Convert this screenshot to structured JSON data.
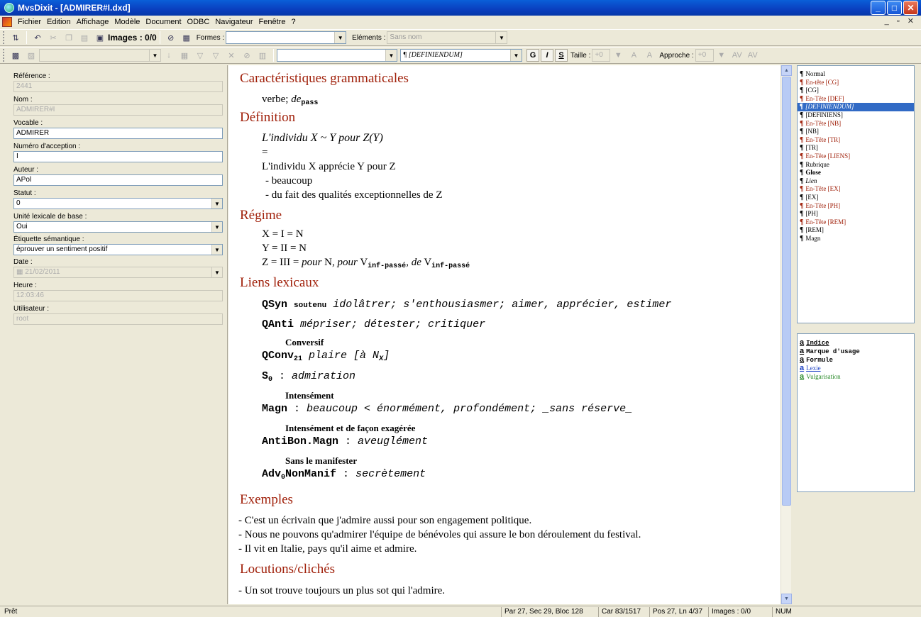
{
  "window": {
    "title": "MvsDixit - [ADMIRER#I.dxd]"
  },
  "menu": [
    "Fichier",
    "Edition",
    "Affichage",
    "Modèle",
    "Document",
    "ODBC",
    "Navigateur",
    "Fenêtre",
    "?"
  ],
  "toolbar1": {
    "images_label": "Images : 0/0",
    "formes_label": "Formes :",
    "formes_value": "",
    "elements_label": "Eléments :",
    "elements_value": "Sans nom"
  },
  "toolbar2": {
    "font_value": "",
    "style_value": "¶ [DEFINIENDUM]",
    "bold": "G",
    "italic": "I",
    "underline": "S",
    "taille_label": "Taille :",
    "taille_value": "+0",
    "approche_label": "Approche :",
    "approche_value": "+0"
  },
  "fields": {
    "reference": {
      "label": "Référence :",
      "value": "2441"
    },
    "nom": {
      "label": "Nom :",
      "value": "ADMIRER#I"
    },
    "vocable": {
      "label": "Vocable :",
      "value": "ADMIRER"
    },
    "numero": {
      "label": "Numéro d'acception :",
      "value": "I"
    },
    "auteur": {
      "label": "Auteur :",
      "value": "APol"
    },
    "statut": {
      "label": "Statut :",
      "value": "0"
    },
    "unite": {
      "label": "Unité lexicale de base :",
      "value": "Oui"
    },
    "etiquette": {
      "label": "Étiquette sémantique :",
      "value": "éprouver un sentiment positif"
    },
    "date": {
      "label": "Date :",
      "value": "21/02/2011"
    },
    "heure": {
      "label": "Heure :",
      "value": "12:03:46"
    },
    "utilisateur": {
      "label": "Utilisateur :",
      "value": "root"
    }
  },
  "doc": {
    "cg_heading": "Caractéristiques grammaticales",
    "cg_text": "verbe; ",
    "cg_de": "de",
    "cg_pass": "pass",
    "def_heading": "Définition",
    "def_formula": "L'individu X ~ Y pour Z(Y)",
    "def_eq": "=",
    "def_line1": "L'individu X apprécie Y pour Z",
    "def_line2": "- beaucoup",
    "def_line3": "- du fait des qualités exceptionnelles de Z",
    "regime_heading": "Régime",
    "regime1": "X = I = N",
    "regime2": "Y = II = N",
    "regime3_a": "Z = III = ",
    "regime3_pour1": "pour",
    "regime3_b": " N, ",
    "regime3_pour2": "pour",
    "regime3_c": " V",
    "regime3_sub1": "inf-passé",
    "regime3_d": ", ",
    "regime3_de": "de",
    "regime3_e": " V",
    "regime3_sub2": "inf-passé",
    "liens_heading": "Liens lexicaux",
    "qsyn_fn": "QSyn",
    "qsyn_usage": "soutenu",
    "qsyn_vals": "idolâtrer; s'enthousiasmer; aimer, apprécier, estimer",
    "qanti_fn": "QAnti",
    "qanti_vals": "mépriser; détester; critiquer",
    "qconv_gloss": "Conversif",
    "qconv_fn": "QConv",
    "qconv_sub": "21",
    "qconv_vals": "plaire [à N",
    "qconv_x": "X",
    "qconv_end": "]",
    "s0_fn": "S",
    "s0_sub": "0",
    "s0_sep": " : ",
    "s0_vals": "admiration",
    "magn_gloss": "Intensément",
    "magn_fn": "Magn",
    "magn_sep": " : ",
    "magn_vals": "beaucoup < énormément, profondément; _sans réserve_",
    "antibon_gloss": "Intensément et de façon exagérée",
    "antibon_fn": "AntiBon.Magn",
    "antibon_sep": " : ",
    "antibon_vals": "aveuglément",
    "adv_gloss": "Sans le manifester",
    "adv_fn_a": "Adv",
    "adv_sub": "0",
    "adv_fn_b": "NonManif",
    "adv_sep": " : ",
    "adv_vals": "secrètement",
    "ex_heading": "Exemples",
    "ex1": "- C'est un écrivain que j'admire aussi pour son engagement politique.",
    "ex2": "- Nous ne pouvons qu'admirer l'équipe de bénévoles qui assure le bon déroulement du festival.",
    "ex3": "- Il vit en Italie, pays qu'il aime et admire.",
    "loc_heading": "Locutions/clichés",
    "loc1": "- Un sot trouve toujours un plus sot qui l'admire."
  },
  "styles": [
    {
      "label": "Normal",
      "kind": "normal"
    },
    {
      "label": "En-tête [CG]",
      "kind": "red"
    },
    {
      "label": "[CG]",
      "kind": "normal"
    },
    {
      "label": "En-Tête [DEF]",
      "kind": "red"
    },
    {
      "label": "[DEFINIENDUM]",
      "kind": "sel"
    },
    {
      "label": "[DEFINIENS]",
      "kind": "normal"
    },
    {
      "label": "En-Tête [NB]",
      "kind": "red"
    },
    {
      "label": "[NB]",
      "kind": "normal"
    },
    {
      "label": "En-Tête [TR]",
      "kind": "red"
    },
    {
      "label": "[TR]",
      "kind": "normal"
    },
    {
      "label": "En-Tête [LIENS]",
      "kind": "red"
    },
    {
      "label": "Rubrique",
      "kind": "normal"
    },
    {
      "label": "Glose",
      "kind": "normal"
    },
    {
      "label": "Lien",
      "kind": "normal"
    },
    {
      "label": "En-Tête [EX]",
      "kind": "red"
    },
    {
      "label": "[EX]",
      "kind": "normal"
    },
    {
      "label": "En-Tête [PH]",
      "kind": "red"
    },
    {
      "label": "[PH]",
      "kind": "normal"
    },
    {
      "label": "En-Tête [REM]",
      "kind": "red"
    },
    {
      "label": "[REM]",
      "kind": "normal"
    },
    {
      "label": "Magn",
      "kind": "normal"
    }
  ],
  "char_styles": [
    {
      "label": "Indice",
      "color": "#000000"
    },
    {
      "label": "Marque d'usage",
      "color": "#000000"
    },
    {
      "label": "Formule",
      "color": "#000000"
    },
    {
      "label": "Lexie",
      "color": "#1a3fc4"
    },
    {
      "label": "Vulgarisation",
      "color": "#2a8a2a"
    }
  ],
  "status": {
    "ready": "Prêt",
    "pos1": "Par 27, Sec 29, Bloc 128",
    "car": "Car 83/1517",
    "pos2": "Pos 27, Ln 4/37",
    "images": "Images : 0/0",
    "num": "NUM"
  }
}
